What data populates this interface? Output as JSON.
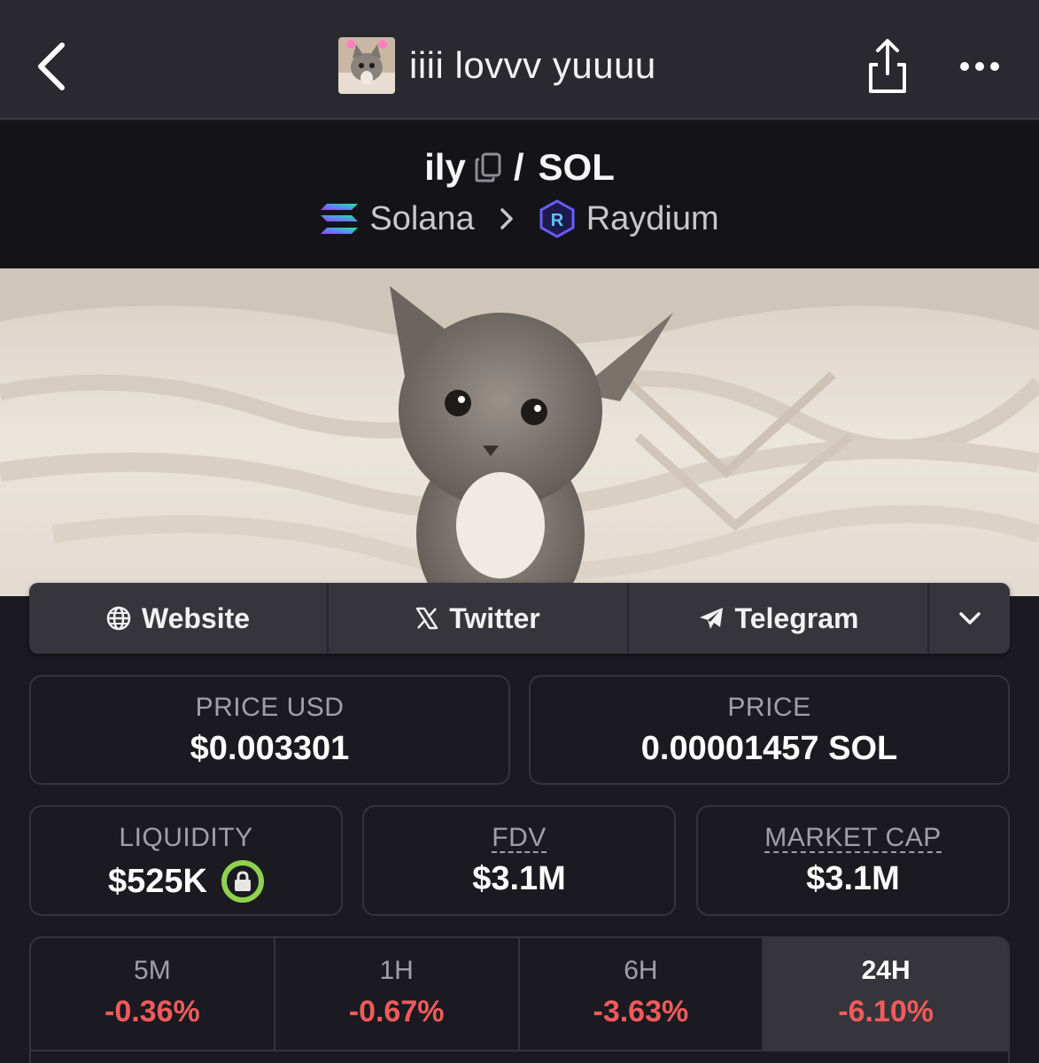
{
  "navbar": {
    "title": "iiii lovvv yuuuu"
  },
  "pair": {
    "base": "ily",
    "separator": "/",
    "quote": "SOL",
    "chain": "Solana",
    "dex": "Raydium"
  },
  "links": {
    "website": "Website",
    "twitter": "Twitter",
    "telegram": "Telegram"
  },
  "stats": {
    "price_usd": {
      "label": "PRICE USD",
      "value": "$0.003301"
    },
    "price_native": {
      "label": "PRICE",
      "value": "0.00001457 SOL"
    },
    "liquidity": {
      "label": "LIQUIDITY",
      "value": "$525K"
    },
    "fdv": {
      "label": "FDV",
      "value": "$3.1M"
    },
    "market_cap": {
      "label": "MARKET CAP",
      "value": "$3.1M"
    }
  },
  "timeframes": [
    {
      "label": "5M",
      "change": "-0.36%"
    },
    {
      "label": "1H",
      "change": "-0.67%"
    },
    {
      "label": "6H",
      "change": "-3.63%"
    },
    {
      "label": "24H",
      "change": "-6.10%",
      "active": true
    }
  ],
  "colors": {
    "negative": "#f25b5b",
    "lock_ring": "#8fd14f",
    "background": "#1a1a20",
    "navbar": "#29292f"
  },
  "icons": [
    "back-chevron-icon",
    "share-icon",
    "more-icon",
    "copy-icon",
    "solana-icon",
    "chevron-right-icon",
    "raydium-icon",
    "globe-icon",
    "x-logo-icon",
    "telegram-icon",
    "chevron-down-icon",
    "lock-icon"
  ]
}
